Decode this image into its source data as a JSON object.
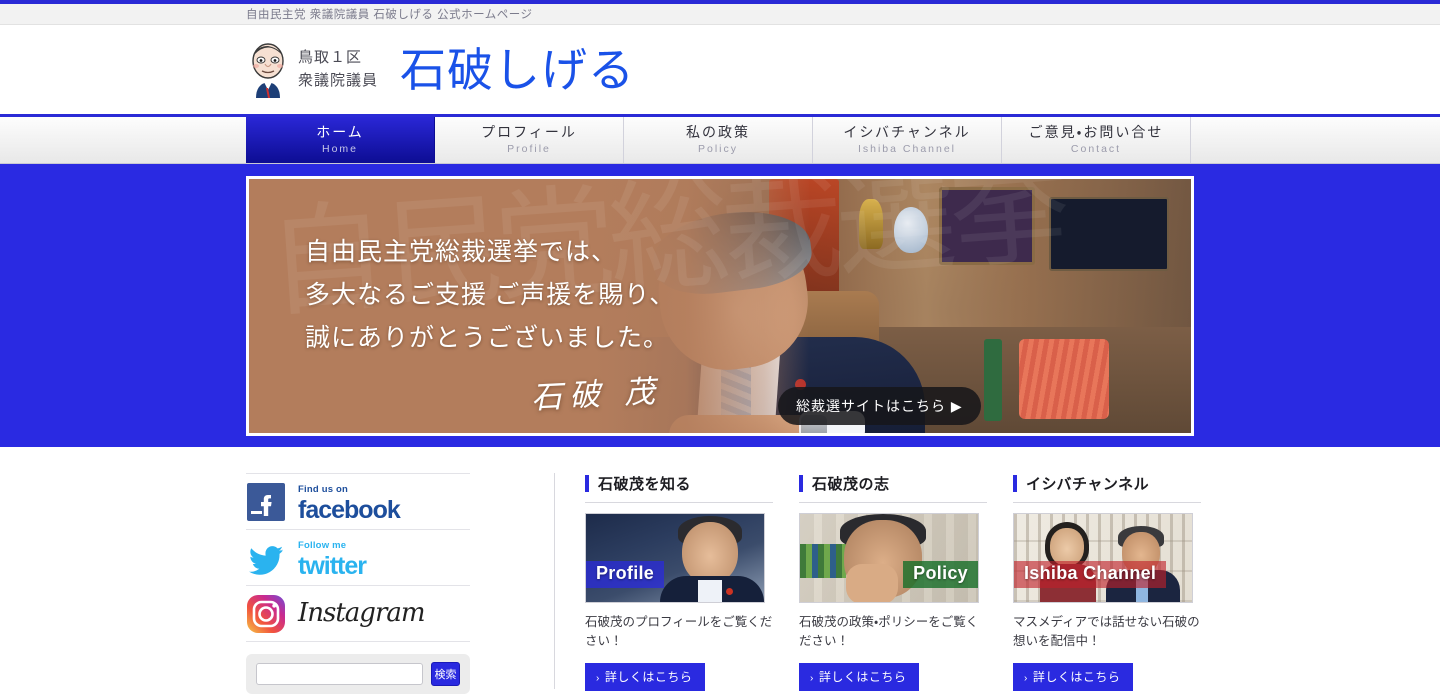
{
  "site": {
    "utility_text": "自由民主党 衆議院議員 石破しげる 公式ホームページ",
    "accent_color": "#2a2ad6",
    "link_color": "#2a2ae0"
  },
  "header": {
    "avatar_icon": "politician-caricature-icon",
    "district": "鳥取１区",
    "position": "衆議院議員",
    "name": "石破しげる",
    "name_color": "#1a52e8"
  },
  "nav": {
    "items": [
      {
        "ja": "ホーム",
        "en": "Home",
        "active": true
      },
      {
        "ja": "プロフィール",
        "en": "Profile",
        "active": false
      },
      {
        "ja": "私の政策",
        "en": "Policy",
        "active": false
      },
      {
        "ja": "イシバチャンネル",
        "en": "Ishiba Channel",
        "active": false
      },
      {
        "ja": "ご意見・お問い合せ",
        "en": "Contact",
        "active": false
      }
    ]
  },
  "hero": {
    "background_color": "#2a2ae2",
    "overlay_color": "#b37d5c",
    "watermark": "自民党総裁選挙",
    "line1": "自由民主党総裁選挙では、",
    "line2": "多大なるご支援 ご声援を賜り、",
    "line3": "誠にありがとうございました。",
    "signature": "石破 茂",
    "cta_label": "総裁選サイトはこちら ▶"
  },
  "sidebar": {
    "social": [
      {
        "id": "facebook",
        "icon": "facebook-icon",
        "kicker": "Find us on",
        "word": "facebook"
      },
      {
        "id": "twitter",
        "icon": "twitter-bird-icon",
        "kicker": "Follow me",
        "word": "twitter"
      },
      {
        "id": "instagram",
        "icon": "instagram-icon",
        "kicker": "",
        "word": "Instagram"
      }
    ],
    "search": {
      "value": "",
      "placeholder": "",
      "button_label": "検索"
    }
  },
  "cards": [
    {
      "title": "石破茂を知る",
      "thumb_label": "Profile",
      "desc": "石破茂のプロフィールをご覧ください！",
      "button_label": "詳しくはこちら"
    },
    {
      "title": "石破茂の志",
      "thumb_label": "Policy",
      "desc": "石破茂の政策・ポリシーをご覧ください！",
      "button_label": "詳しくはこちら"
    },
    {
      "title": "イシバチャンネル",
      "thumb_label": "Ishiba Channel",
      "desc": "マスメディアでは話せない石破の想いを配信中！",
      "button_label": "詳しくはこちら"
    }
  ]
}
